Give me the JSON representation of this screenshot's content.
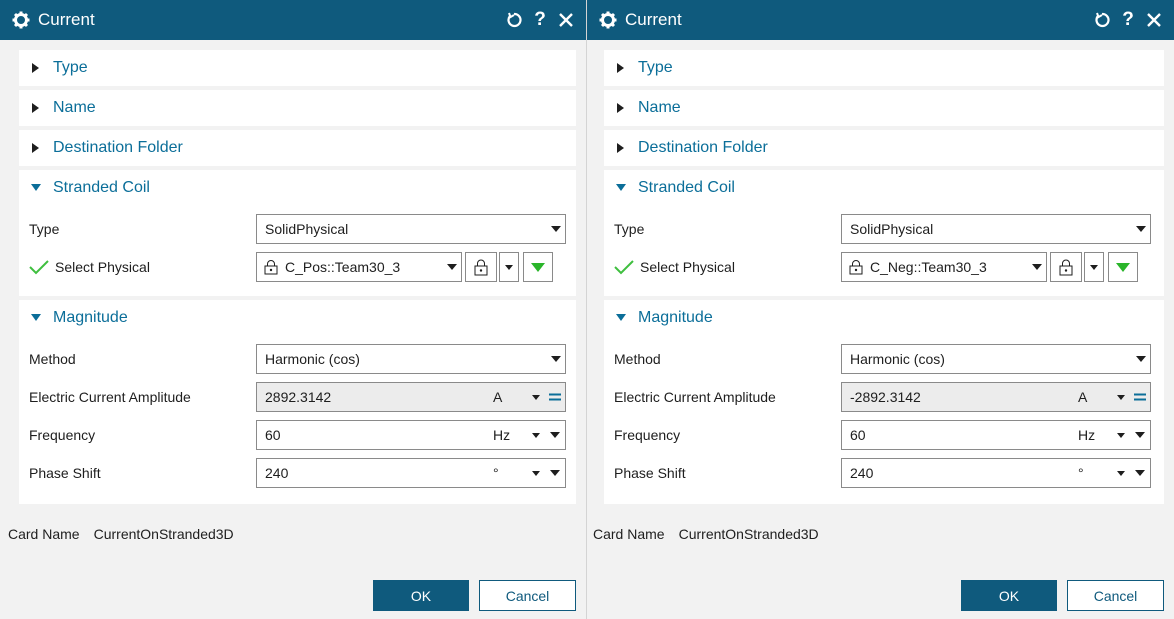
{
  "dialogs": [
    {
      "title": "Current",
      "sections": {
        "type_label": "Type",
        "name_label": "Name",
        "dest_label": "Destination Folder",
        "stranded_label": "Stranded Coil",
        "magnitude_label": "Magnitude"
      },
      "stranded": {
        "type_label": "Type",
        "type_value": "SolidPhysical",
        "select_label": "Select Physical",
        "select_value": "C_Pos::Team30_3"
      },
      "magnitude": {
        "method_label": "Method",
        "method_value": "Harmonic (cos)",
        "amp_label": "Electric Current Amplitude",
        "amp_value": "2892.3142",
        "amp_unit": "A",
        "freq_label": "Frequency",
        "freq_value": "60",
        "freq_unit": "Hz",
        "phase_label": "Phase Shift",
        "phase_value": "240",
        "phase_unit": "°"
      },
      "card_label": "Card Name",
      "card_value": "CurrentOnStranded3D",
      "ok": "OK",
      "cancel": "Cancel"
    },
    {
      "title": "Current",
      "sections": {
        "type_label": "Type",
        "name_label": "Name",
        "dest_label": "Destination Folder",
        "stranded_label": "Stranded Coil",
        "magnitude_label": "Magnitude"
      },
      "stranded": {
        "type_label": "Type",
        "type_value": "SolidPhysical",
        "select_label": "Select Physical",
        "select_value": "C_Neg::Team30_3"
      },
      "magnitude": {
        "method_label": "Method",
        "method_value": "Harmonic (cos)",
        "amp_label": "Electric Current Amplitude",
        "amp_value": "-2892.3142",
        "amp_unit": "A",
        "freq_label": "Frequency",
        "freq_value": "60",
        "freq_unit": "Hz",
        "phase_label": "Phase Shift",
        "phase_value": "240",
        "phase_unit": "°"
      },
      "card_label": "Card Name",
      "card_value": "CurrentOnStranded3D",
      "ok": "OK",
      "cancel": "Cancel"
    }
  ],
  "colors": {
    "titlebar": "#0f5a7d",
    "accent": "#0b6e99",
    "check": "#3fbf3f",
    "green_arrow": "#2ab52a"
  }
}
